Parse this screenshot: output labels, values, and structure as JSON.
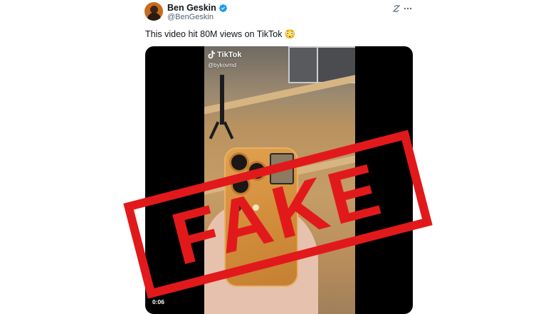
{
  "tweet": {
    "author_name": "Ben Geskin",
    "author_handle": "@BenGeskin",
    "text": "This video hit 80M views on TikTok 😳",
    "icons": {
      "verified": "verified-badge-icon",
      "grok": "grok-icon",
      "more": "more-options-icon"
    },
    "colors": {
      "verified": "#1d9bf0",
      "handle": "#536471"
    }
  },
  "media": {
    "watermark_brand": "TikTok",
    "watermark_user": "@bykovmd",
    "timestamp": "0:06"
  },
  "overlay": {
    "stamp_text": "FAKE",
    "stamp_color": "#e2191b"
  }
}
